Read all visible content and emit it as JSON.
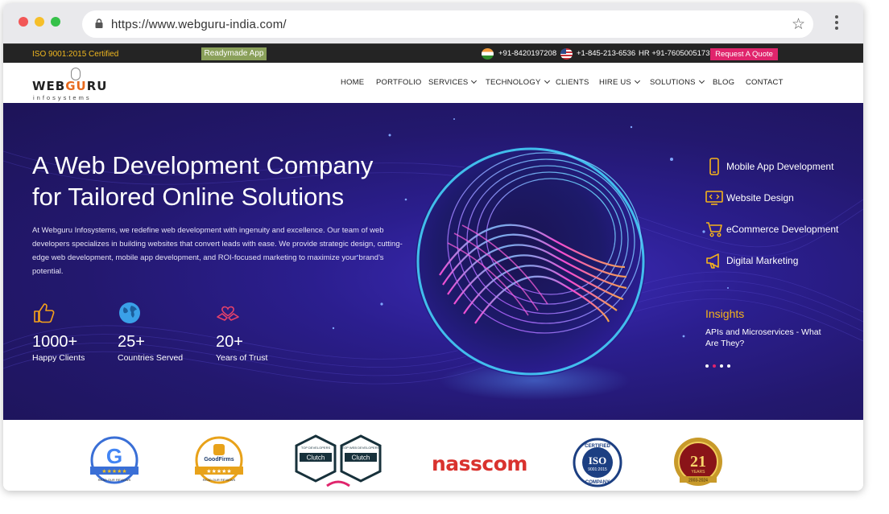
{
  "browser": {
    "url": "https://www.webguru-india.com/"
  },
  "topbar": {
    "iso": "ISO 9001:2015 Certified",
    "readymade": "Readymade App",
    "phone_india": "+91-8420197208",
    "phone_us": "+1-845-213-6536",
    "phone_hr": "HR +91-7605005173",
    "quote": "Request A Quote"
  },
  "logo": {
    "name_left": "WEB",
    "name_mid": "GU",
    "name_right": "RU",
    "tagline": "infosystems"
  },
  "nav": {
    "items": [
      "HOME",
      "PORTFOLIO",
      "SERVICES",
      "TECHNOLOGY",
      "CLIENTS",
      "HIRE US",
      "SOLUTIONS",
      "BLOG",
      "CONTACT"
    ]
  },
  "hero": {
    "title_line1": "A Web Development Company",
    "title_line2": "for Tailored Online Solutions",
    "description": "At Webguru Infosystems, we redefine web development with ingenuity and excellence. Our team of web developers specializes in building websites that convert leads with ease. We provide strategic design, cutting-edge web development, mobile app development, and ROI-focused marketing to maximize your brand’s potential.",
    "stats": [
      {
        "value": "1000+",
        "label": "Happy Clients",
        "icon": "thumbs-up-icon"
      },
      {
        "value": "25+",
        "label": "Countries Served",
        "icon": "globe-icon"
      },
      {
        "value": "20+",
        "label": "Years of Trust",
        "icon": "handshake-heart-icon"
      }
    ],
    "services": [
      {
        "label": "Mobile App Development",
        "icon": "mobile-icon"
      },
      {
        "label": "Website Design",
        "icon": "code-monitor-icon"
      },
      {
        "label": "eCommerce Development",
        "icon": "cart-icon"
      },
      {
        "label": "Digital Marketing",
        "icon": "megaphone-icon"
      }
    ],
    "insights_title": "Insights",
    "insights_text": "APIs and Microservices - What Are They?"
  },
  "badges": {
    "google": "G",
    "google_caption": "READ OUR REVIEWS",
    "goodfirms": "GoodFirms",
    "goodfirms_caption": "READ OUR REVIEWS",
    "clutch1_top": "TOP DEVELOPERS",
    "clutch1": "Clutch",
    "clutch2_top": "TOP WEB DEVELOPERS",
    "clutch2": "Clutch",
    "nasscom": "nasscom",
    "iso_top": "CERTIFIED",
    "iso_mid": "ISO",
    "iso_num": "9001:2015",
    "iso_bottom": "COMPANY",
    "anniv_num": "21",
    "anniv_years": "YEARS",
    "anniv_range": "2003-2024"
  },
  "colors": {
    "accent_pink": "#e0246c",
    "accent_orange": "#f6b31a",
    "hero_bg": "#241876"
  }
}
